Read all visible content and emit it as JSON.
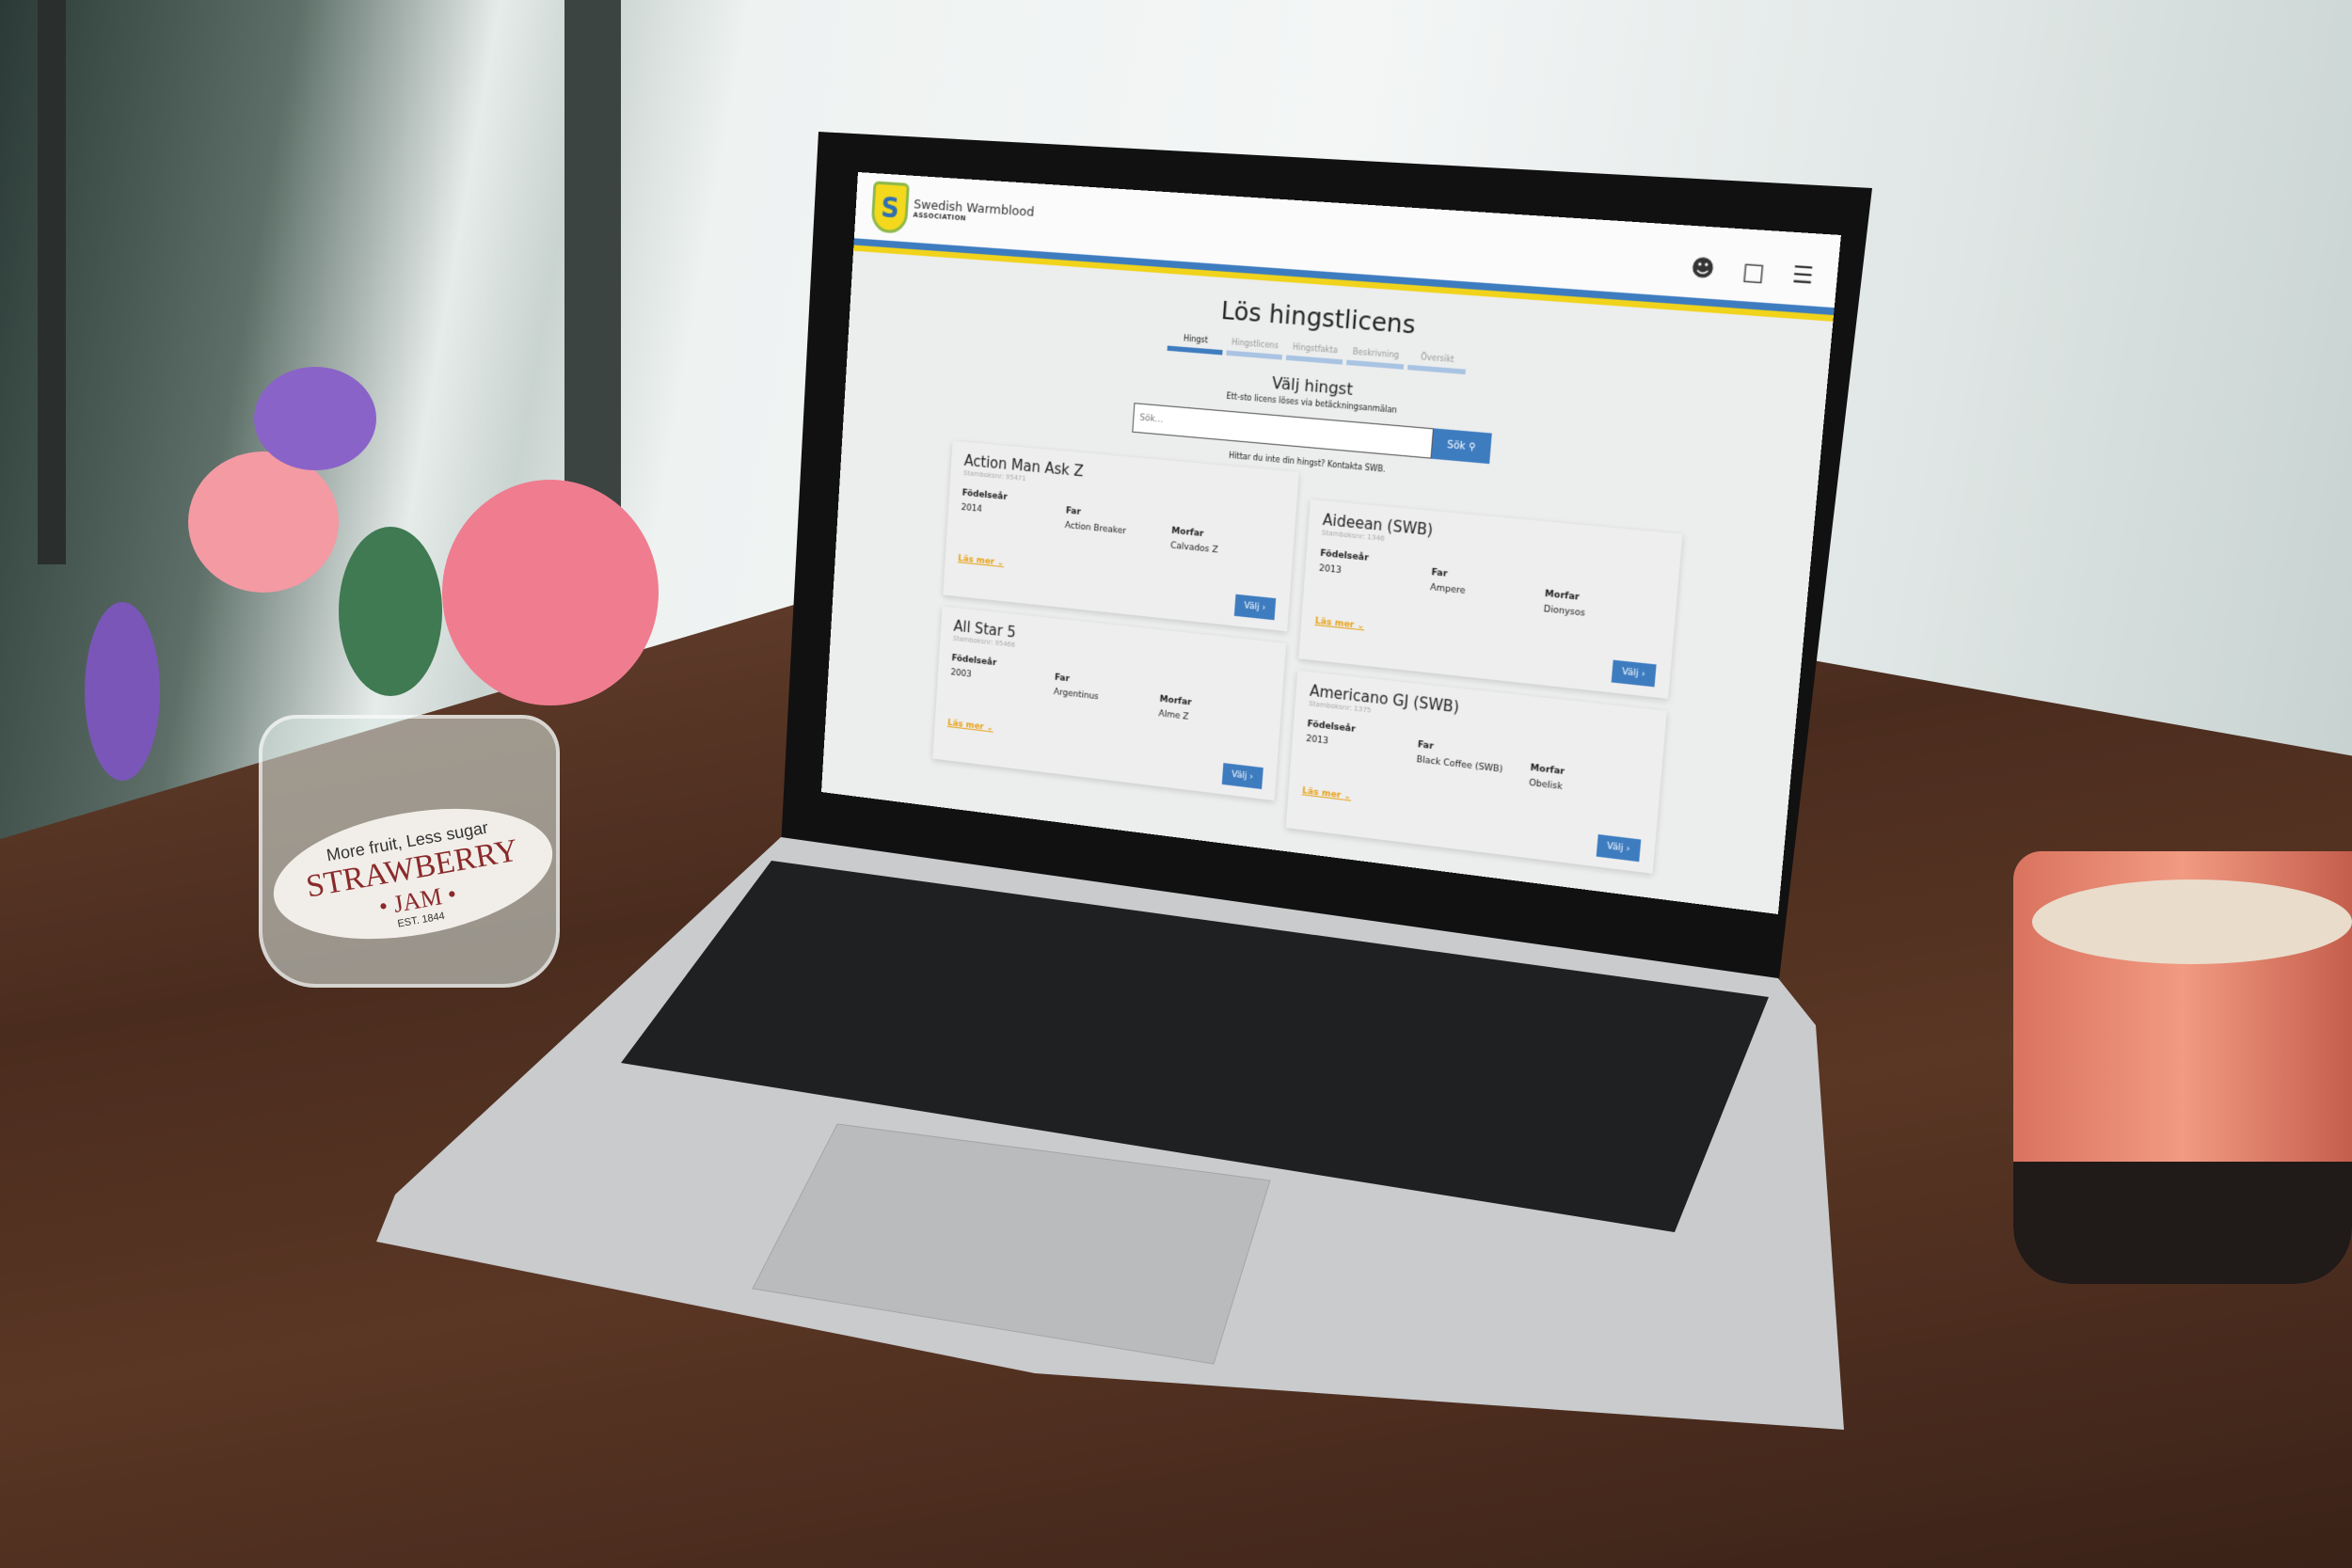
{
  "header": {
    "brand": "Swedish Warmblood",
    "brand_sub": "ASSOCIATION",
    "logo_letter": "S"
  },
  "page": {
    "title": "Lös hingstlicens",
    "section_title": "Välj hingst",
    "section_subtitle": "Ett-sto licens löses via betäckningsanmälan",
    "search_placeholder": "Sök...",
    "search_button": "Sök",
    "help_text": "Hittar du inte din hingst? Kontakta SWB."
  },
  "steps": [
    {
      "label": "Hingst",
      "active": true
    },
    {
      "label": "Hingstlicens"
    },
    {
      "label": "Hingstfakta"
    },
    {
      "label": "Beskrivning"
    },
    {
      "label": "Översikt"
    }
  ],
  "labels": {
    "birth_year": "Födelseår",
    "father": "Far",
    "maternal_grandfather": "Morfar",
    "read_more": "Läs mer",
    "select": "Välj ›"
  },
  "horses": [
    {
      "name": "Action Man Ask Z",
      "studbook": "Stamboksnr: 95471",
      "year": "2014",
      "father": "Action Breaker",
      "morfar": "Calvados Z"
    },
    {
      "name": "All Star 5",
      "studbook": "Stamboksnr: 95466",
      "year": "2003",
      "father": "Argentinus",
      "morfar": "Alme Z"
    },
    {
      "name": "Aideean (SWB)",
      "studbook": "Stamboksnr: 1346",
      "year": "2013",
      "father": "Ampere",
      "morfar": "Dionysos"
    },
    {
      "name": "Americano GJ (SWB)",
      "studbook": "Stamboksnr: 1375",
      "year": "2013",
      "father": "Black Coffee (SWB)",
      "morfar": "Obelisk"
    }
  ],
  "scene": {
    "jar_line1": "More fruit, Less sugar",
    "jar_line2": "STRAWBERRY",
    "jar_line3": "• JAM •",
    "jar_line4": "EST. 1844"
  },
  "colors": {
    "brand_blue": "#3e7cc0",
    "brand_yellow": "#f0d31a",
    "link": "#e7a31a"
  }
}
